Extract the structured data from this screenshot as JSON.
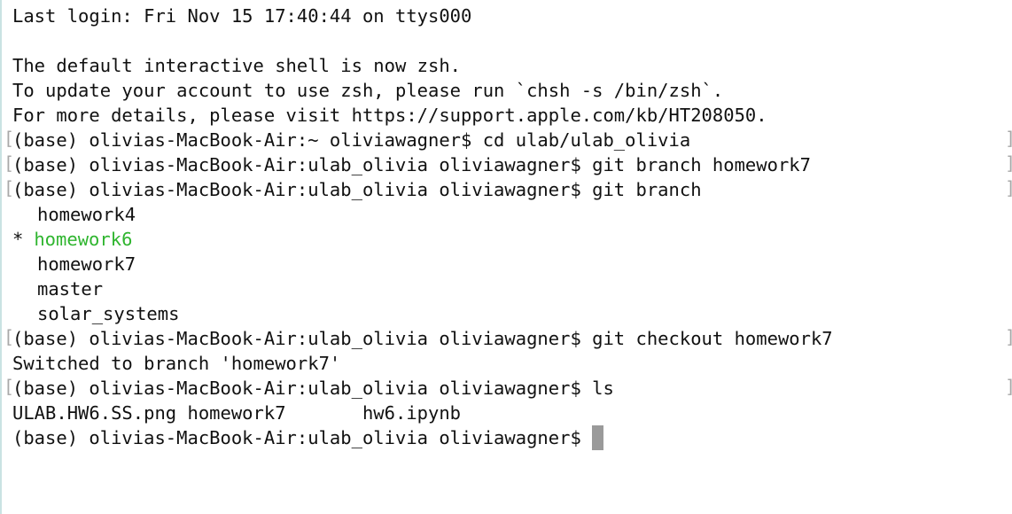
{
  "terminal": {
    "login": "Last login: Fri Nov 15 17:40:44 on ttys000",
    "shell_notice": "The default interactive shell is now zsh.",
    "update_notice": "To update your account to use zsh, please run `chsh -s /bin/zsh`.",
    "details_notice": "For more details, please visit https://support.apple.com/kb/HT208050.",
    "commands": [
      "(base) olivias-MacBook-Air:~ oliviawagner$ cd ulab/ulab_olivia",
      "(base) olivias-MacBook-Air:ulab_olivia oliviawagner$ git branch homework7",
      "(base) olivias-MacBook-Air:ulab_olivia oliviawagner$ git branch",
      "(base) olivias-MacBook-Air:ulab_olivia oliviawagner$ git checkout homework7",
      "(base) olivias-MacBook-Air:ulab_olivia oliviawagner$ ls"
    ],
    "branches": {
      "current_marker": "*",
      "items": [
        "homework4",
        "homework6",
        "homework7",
        "master",
        "solar_systems"
      ]
    },
    "checkout_output": "Switched to branch 'homework7'",
    "ls_output": "ULAB.HW6.SS.png homework7       hw6.ipynb",
    "prompt": "(base) olivias-MacBook-Air:ulab_olivia oliviawagner$",
    "bracket_left": "[",
    "bracket_right": "]",
    "colors": {
      "current_branch": "#2fb52f",
      "cursor": "#9a9a9a",
      "text": "#111111"
    }
  }
}
